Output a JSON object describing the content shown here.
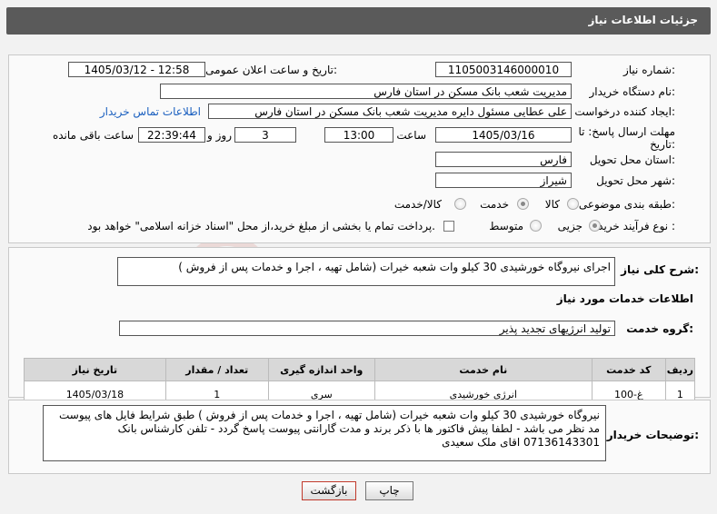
{
  "header": {
    "title": "جزئیات اطلاعات نیاز"
  },
  "form": {
    "need_number_label": "شماره نیاز:",
    "need_number": "1105003146000010",
    "announce_label": "تاریخ و ساعت اعلان عمومی:",
    "announce_value": "1405/03/12 - 12:58",
    "buyer_org_label": "نام دستگاه خریدار:",
    "buyer_org": "مدیریت شعب بانک مسکن در استان فارس",
    "creator_label": "ایجاد کننده درخواست:",
    "creator": "علی عطایی مسئول دایره مدیریت شعب بانک مسکن در استان فارس",
    "contact_link": "اطلاعات تماس خریدار",
    "deadline_label": "مهلت ارسال پاسخ: تا تاریخ:",
    "deadline_date": "1405/03/16",
    "time_label": "ساعت",
    "deadline_time": "13:00",
    "days_value": "3",
    "days_label": "روز و",
    "remaining_value": "22:39:44",
    "remaining_label": "ساعت باقی مانده",
    "province_label": "استان محل تحویل:",
    "province": "فارس",
    "city_label": "شهر محل تحویل:",
    "city": "شیراز",
    "category_label": "طبقه بندی موضوعی:",
    "category_options": [
      "کالا",
      "خدمت",
      "کالا/خدمت"
    ],
    "category_selected": "خدمت",
    "process_label": "نوع فرآیند خرید :",
    "process_options": [
      "جزیی",
      "متوسط"
    ],
    "process_note": "پرداخت تمام یا بخشی از مبلغ خرید،از محل \"اسناد خزانه اسلامی\" خواهد بود."
  },
  "summary": {
    "label": "شرح کلی نیاز:",
    "value": "اجرای نیروگاه خورشیدی 30 کیلو وات شعبه خیرات  (شامل تهیه ، اجرا و خدمات پس از فروش )",
    "services_heading": "اطلاعات خدمات مورد نیاز",
    "group_label": "گروه خدمت:",
    "group_value": "تولید انرژیهای تجدید پذیر"
  },
  "table": {
    "headers": [
      "ردیف",
      "کد خدمت",
      "نام خدمت",
      "واحد اندازه گیری",
      "تعداد / مقدار",
      "تاریخ نیاز"
    ],
    "rows": [
      [
        "1",
        "غ-100",
        "انرژی خورشیدی",
        "سری",
        "1",
        "1405/03/18"
      ]
    ]
  },
  "buyer_notes": {
    "label": "توضیحات خریدار:",
    "value": "نیروگاه خورشیدی 30 کیلو وات شعبه خیرات  (شامل تهیه ، اجرا و خدمات پس از فروش ) طبق شرایط فایل های پیوست مد نظر می باشد  - لطفا پیش فاکتور ها با ذکر برند و مدت گارانتی پیوست پاسخ گردد - تلفن کارشناس بانک 07136143301 اقای ملک سعیدی"
  },
  "buttons": {
    "print": "چاپ",
    "back": "بازگشت"
  },
  "watermark_text": "AriaTender.net",
  "colors": {
    "title_bar": "#5a5a5a",
    "link": "#1a5fbf",
    "back_button_border": "#c0392b"
  }
}
